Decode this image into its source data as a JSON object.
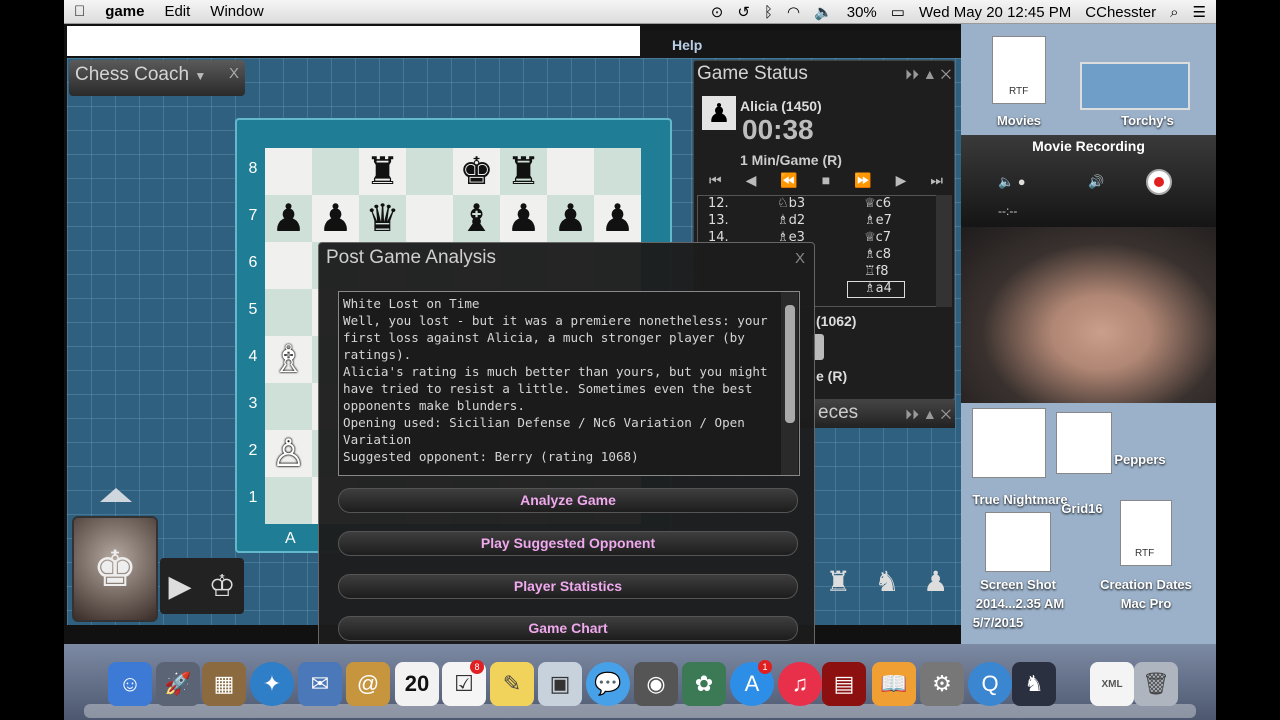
{
  "menubar": {
    "app": "game",
    "items": [
      "Edit",
      "Window"
    ],
    "battery": "30%",
    "datetime": "Wed May 20  12:45 PM",
    "user": "CChesster"
  },
  "help": "Help",
  "coach": {
    "title": "Chess Coach",
    "close": "X"
  },
  "board": {
    "ranks": [
      "8",
      "7",
      "6",
      "5",
      "4",
      "3",
      "2",
      "1"
    ],
    "file_label": "A",
    "rows": [
      [
        "",
        "",
        "♜",
        "",
        "♚",
        "♜",
        "",
        ""
      ],
      [
        "♟",
        "♟",
        "♛",
        "",
        "♝",
        "♟",
        "♟",
        "♟"
      ],
      [
        "",
        "",
        "",
        "",
        "",
        "",
        "",
        ""
      ],
      [
        "",
        "",
        "",
        "",
        "",
        "",
        "",
        ""
      ],
      [
        "♗",
        "",
        "",
        "",
        "",
        "",
        "",
        ""
      ],
      [
        "",
        "",
        "",
        "",
        "",
        "",
        "",
        ""
      ],
      [
        "♙",
        "",
        "",
        "",
        "",
        "",
        "",
        ""
      ],
      [
        "",
        "",
        "",
        "",
        "",
        "",
        "",
        ""
      ]
    ]
  },
  "game_status": {
    "title": "Game Status",
    "opponent": "Alicia (1450)",
    "clock": "00:38",
    "time_control": "1 Min/Game (R)",
    "moves": [
      {
        "num": "12.",
        "white": "♘b3",
        "black": "♕c6"
      },
      {
        "num": "13.",
        "white": "♗d2",
        "black": "♗e7"
      },
      {
        "num": "14.",
        "white": "♗e3",
        "black": "♕c7"
      },
      {
        "num": "",
        "white": "",
        "black": "♗c8"
      },
      {
        "num": "",
        "white": "",
        "black": "♖f8"
      },
      {
        "num": "",
        "white": "",
        "black": "♗a4"
      }
    ],
    "player_rating_partial": "(1062)",
    "player_tc_partial": "e (R)"
  },
  "pieces_panel": {
    "title_partial": "eces"
  },
  "post_game": {
    "title": "Post Game Analysis",
    "close": "X",
    "lines": [
      "White Lost on Time",
      "Well, you lost - but it was a premiere nonetheless: your",
      "first loss against Alicia, a much stronger player (by",
      "ratings).",
      "Alicia's rating is much better than yours, but you might",
      "have tried to resist a little. Sometimes even the best",
      "opponents make blunders.",
      "Opening used: Sicilian Defense / Nc6 Variation / Open",
      "Variation",
      "Suggested opponent: Berry (rating 1068)"
    ],
    "buttons": [
      "Analyze Game",
      "Play Suggested Opponent",
      "Player Statistics",
      "Game Chart"
    ]
  },
  "movie_recording": {
    "title": "Movie Recording",
    "time": "--:--"
  },
  "desktop": {
    "items": [
      "Movies",
      "Torchy's",
      "Peppers",
      "True Nightmare",
      "Grid16",
      "Creation Dates",
      "Mac Pro",
      "Screen Shot",
      "2014...2.35 AM",
      "5/7/2015"
    ],
    "file_tags": [
      "RTF",
      "RTF",
      "RTF"
    ]
  },
  "dock": {
    "calendar_date": "20",
    "reminders_badge": "8",
    "appstore_badge": "1",
    "file_tag": "XML"
  }
}
